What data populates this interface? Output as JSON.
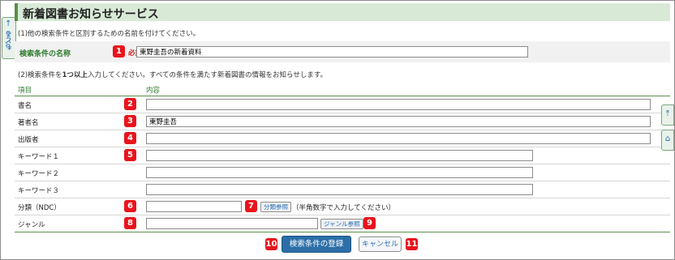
{
  "title": "新着図書お知らせサービス",
  "back_tab": {
    "label": "もどる",
    "icon": "arrow-up-icon"
  },
  "side_buttons": {
    "top_icon": "to-top-icon",
    "home_icon": "home-icon"
  },
  "instructions": {
    "line1": "(1)他の検索条件と区別するための名前を付けてください。",
    "line2_pre": "(2)検索条件を",
    "line2_bold": "1つ以上",
    "line2_post": "入力してください。すべての条件を満たす新着図書の情報をお知らせします。"
  },
  "condition_name": {
    "label": "検索条件の名称",
    "required": "必須",
    "value": "東野圭吾の新着資料"
  },
  "table": {
    "col_item": "項目",
    "col_content": "内容",
    "rows": {
      "title": {
        "label": "書名",
        "value": ""
      },
      "author": {
        "label": "著者名",
        "value": "東野圭吾"
      },
      "publisher": {
        "label": "出版者",
        "value": ""
      },
      "keyword1": {
        "label": "キーワード１",
        "value": ""
      },
      "keyword2": {
        "label": "キーワード２",
        "value": ""
      },
      "keyword3": {
        "label": "キーワード３",
        "value": ""
      },
      "ndc": {
        "label": "分類（NDC）",
        "value": "",
        "button": "分類参照",
        "hint": "（半角数字で入力してください）"
      },
      "genre": {
        "label": "ジャンル",
        "value": "",
        "button": "ジャンル参照"
      }
    }
  },
  "actions": {
    "register": "検索条件の登録",
    "cancel": "キャンセル"
  },
  "callouts": [
    "1",
    "2",
    "3",
    "4",
    "5",
    "6",
    "7",
    "8",
    "9",
    "10",
    "11"
  ],
  "colors": {
    "accent_green": "#5a8f4a",
    "title_bg": "#d8ead6",
    "primary_button": "#2c6fa8",
    "badge_red": "#e8141d"
  }
}
